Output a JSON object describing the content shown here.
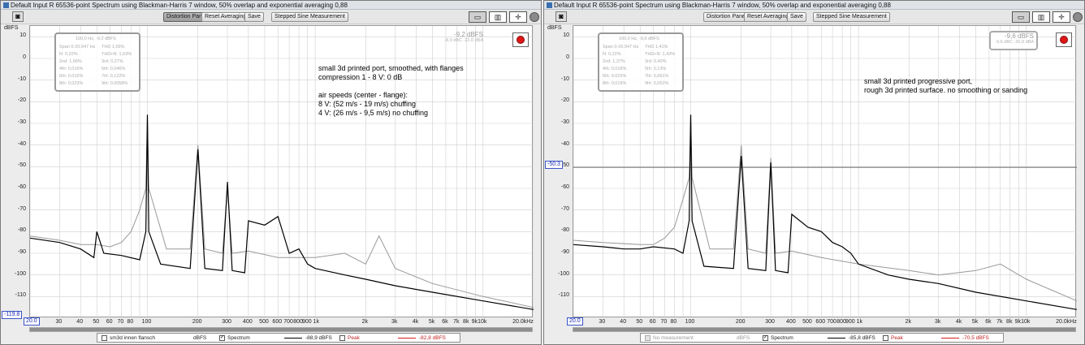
{
  "windows": [
    {
      "title": "Default Input R 65536-point Spectrum using Blackman-Harris 7 window, 50% overlap and exponential averaging 0,88",
      "toolbar": {
        "distortion_panel": "Distortion Panel",
        "reset_averaging": "Reset Averaging",
        "save": "Save",
        "stepped_sine": "Stepped Sine Measurement"
      },
      "y_unit": "dBFS",
      "y_ticks": [
        "10",
        "0",
        "-10",
        "-20",
        "-30",
        "-40",
        "-50",
        "-60",
        "-70",
        "-80",
        "-90",
        "-100",
        "-110"
      ],
      "x_ticks": [
        {
          "label": "30",
          "f": 30
        },
        {
          "label": "40",
          "f": 40
        },
        {
          "label": "50",
          "f": 50
        },
        {
          "label": "60",
          "f": 60
        },
        {
          "label": "70",
          "f": 70
        },
        {
          "label": "80",
          "f": 80
        },
        {
          "label": "100",
          "f": 100
        },
        {
          "label": "200",
          "f": 200
        },
        {
          "label": "300",
          "f": 300
        },
        {
          "label": "400",
          "f": 400
        },
        {
          "label": "500",
          "f": 500
        },
        {
          "label": "600",
          "f": 600
        },
        {
          "label": "700",
          "f": 700
        },
        {
          "label": "800",
          "f": 800
        },
        {
          "label": "900 1k",
          "f": 950
        },
        {
          "label": "2k",
          "f": 2000
        },
        {
          "label": "3k",
          "f": 3000
        },
        {
          "label": "4k",
          "f": 4000
        },
        {
          "label": "5k",
          "f": 5000
        },
        {
          "label": "6k",
          "f": 6000
        },
        {
          "label": "7k",
          "f": 7000
        },
        {
          "label": "8k",
          "f": 8000
        },
        {
          "label": "9k",
          "f": 9000
        },
        {
          "label": "10k",
          "f": 10000
        },
        {
          "label": "20.0kHz",
          "f": 20000
        }
      ],
      "x_start_label": "20.0",
      "y_cursor_label": "-119.8",
      "level": {
        "main": "-9,2 dBFS",
        "sub": "-8,9 dBC   -22,0 dBA"
      },
      "distortion": {
        "header": "100,0 Hz,  -9,2 dBFS",
        "rows": [
          [
            "Span 0-20.947 Hz",
            "THD 1,66%"
          ],
          [
            "N: 0,22%",
            "THD+N: 1,63%"
          ],
          [
            "2nd: 1,66%",
            "3rd: 0,27%"
          ],
          [
            "4th: 0,016%",
            "5th: 0,046%"
          ],
          [
            "6th: 0,016%",
            "7th: 0,122%"
          ],
          [
            "8th: 0,023%",
            "9th: 0,0058%"
          ]
        ]
      },
      "annotation": "small 3d printed port, smoothed, with flanges\ncompression 1 - 8 V: 0 dB\n\nair speeds (center - flange):\n8 V: (52 m/s - 19 m/s) chuffing\n4 V: (26 m/s - 9,5 m/s) no chuffing",
      "legend": {
        "overlay_name": "sm3d innen flansch",
        "overlay_unit": "dBFS",
        "spectrum": "Spectrum",
        "spectrum_value": "-88,9 dBFS",
        "peak": "Peak",
        "peak_value": "-82,8 dBFS"
      },
      "horizontal_cursor": null
    },
    {
      "title": "Default Input R 65536-point Spectrum using Blackman-Harris 7 window, 50% overlap and exponential averaging 0,88",
      "toolbar": {
        "distortion_panel": "Distortion Panel",
        "reset_averaging": "Reset Averaging",
        "save": "Save",
        "stepped_sine": "Stepped Sine Measurement"
      },
      "y_unit": "dBFS",
      "y_ticks": [
        "10",
        "0",
        "-10",
        "-20",
        "-30",
        "-40",
        "-50",
        "-60",
        "-70",
        "-80",
        "-90",
        "-100",
        "-110"
      ],
      "x_ticks": [
        {
          "label": "30",
          "f": 30
        },
        {
          "label": "40",
          "f": 40
        },
        {
          "label": "50",
          "f": 50
        },
        {
          "label": "60",
          "f": 60
        },
        {
          "label": "70",
          "f": 70
        },
        {
          "label": "80",
          "f": 80
        },
        {
          "label": "100",
          "f": 100
        },
        {
          "label": "200",
          "f": 200
        },
        {
          "label": "300",
          "f": 300
        },
        {
          "label": "400",
          "f": 400
        },
        {
          "label": "500",
          "f": 500
        },
        {
          "label": "600",
          "f": 600
        },
        {
          "label": "700",
          "f": 700
        },
        {
          "label": "800",
          "f": 800
        },
        {
          "label": "900 1k",
          "f": 950
        },
        {
          "label": "2k",
          "f": 2000
        },
        {
          "label": "3k",
          "f": 3000
        },
        {
          "label": "4k",
          "f": 4000
        },
        {
          "label": "5k",
          "f": 5000
        },
        {
          "label": "6k",
          "f": 6000
        },
        {
          "label": "7k",
          "f": 7000
        },
        {
          "label": "8k",
          "f": 8000
        },
        {
          "label": "9k",
          "f": 9000
        },
        {
          "label": "10k",
          "f": 10000
        },
        {
          "label": "20.0kHz",
          "f": 20000
        }
      ],
      "x_start_label": "20.0",
      "y_cursor_label": "-50.3",
      "level": {
        "main": "-9,6 dBFS",
        "sub": "-9,6 dBC   -20,9 dBA"
      },
      "distortion": {
        "header": "100,0 Hz,  -9,6 dBFS",
        "rows": [
          [
            "Span 0-20.947 Hz",
            "THD 1,41%"
          ],
          [
            "N: 0,22%",
            "THD+N: 1,43%"
          ],
          [
            "2nd: 1,37%",
            "3rd: 0,40%"
          ],
          [
            "4th: 0,018%",
            "5th: 0,13%"
          ],
          [
            "6th: 0,023%",
            "7th: 0,061%"
          ],
          [
            "8th: 0,019%",
            "9th: 0,052%"
          ]
        ]
      },
      "annotation": "small 3d printed progressive port,\nrough 3d printed surface. no smoothing or sanding",
      "legend": {
        "overlay_name": "No measurement",
        "overlay_unit": "dBFS",
        "spectrum": "Spectrum",
        "spectrum_value": "-85,8 dBFS",
        "peak": "Peak",
        "peak_value": "-70,5 dBFS"
      },
      "horizontal_cursor": -50.3
    }
  ],
  "chart_data": [
    {
      "type": "line",
      "title": "",
      "xlabel": "",
      "ylabel": "dBFS",
      "x_scale": "log",
      "xlim": [
        20,
        20000
      ],
      "ylim": [
        -120,
        15
      ],
      "series": [
        {
          "name": "Spectrum",
          "color": "#000000",
          "x": [
            20,
            30,
            40,
            48,
            50,
            55,
            70,
            90,
            98,
            100,
            102,
            120,
            180,
            200,
            220,
            280,
            300,
            320,
            380,
            400,
            500,
            600,
            700,
            800,
            900,
            1000,
            1500,
            2000,
            3000,
            5000,
            10000,
            20000
          ],
          "y": [
            -83,
            -85,
            -88,
            -92,
            -80,
            -90,
            -91,
            -93,
            -80,
            -26,
            -80,
            -95,
            -97,
            -42,
            -97,
            -98,
            -57,
            -98,
            -99,
            -75,
            -77,
            -73,
            -90,
            -88,
            -95,
            -97,
            -100,
            -102,
            -105,
            -108,
            -112,
            -116
          ]
        },
        {
          "name": "sm3d innen flansch",
          "color": "#999999",
          "x": [
            20,
            30,
            40,
            50,
            60,
            70,
            80,
            90,
            98,
            100,
            102,
            130,
            180,
            200,
            220,
            280,
            300,
            320,
            400,
            600,
            1000,
            1500,
            2000,
            2400,
            3000,
            5000,
            10000,
            20000
          ],
          "y": [
            -82,
            -84,
            -86,
            -86,
            -87,
            -85,
            -80,
            -70,
            -60,
            -27,
            -60,
            -88,
            -88,
            -40,
            -88,
            -90,
            -60,
            -90,
            -89,
            -92,
            -92,
            -90,
            -95,
            -82,
            -97,
            -104,
            -110,
            -115
          ]
        }
      ]
    },
    {
      "type": "line",
      "title": "",
      "xlabel": "",
      "ylabel": "dBFS",
      "x_scale": "log",
      "xlim": [
        20,
        20000
      ],
      "ylim": [
        -120,
        15
      ],
      "series": [
        {
          "name": "Spectrum",
          "color": "#000000",
          "x": [
            20,
            30,
            40,
            50,
            60,
            80,
            90,
            98,
            100,
            102,
            120,
            180,
            200,
            220,
            280,
            300,
            320,
            380,
            400,
            500,
            600,
            700,
            800,
            900,
            1000,
            1500,
            2000,
            3000,
            5000,
            10000,
            20000
          ],
          "y": [
            -86,
            -87,
            -88,
            -88,
            -87,
            -88,
            -90,
            -75,
            -26,
            -75,
            -96,
            -97,
            -45,
            -97,
            -98,
            -48,
            -98,
            -99,
            -72,
            -78,
            -80,
            -85,
            -87,
            -90,
            -95,
            -100,
            -102,
            -104,
            -108,
            -112,
            -116
          ]
        },
        {
          "name": "Peak",
          "color": "#999999",
          "x": [
            20,
            30,
            50,
            60,
            70,
            80,
            90,
            98,
            100,
            102,
            130,
            180,
            200,
            220,
            280,
            300,
            320,
            400,
            600,
            1000,
            2000,
            3000,
            5000,
            7000,
            10000,
            20000
          ],
          "y": [
            -84,
            -85,
            -86,
            -86,
            -83,
            -78,
            -65,
            -55,
            -26,
            -55,
            -88,
            -88,
            -40,
            -88,
            -90,
            -46,
            -90,
            -89,
            -92,
            -95,
            -98,
            -100,
            -98,
            -95,
            -102,
            -112
          ]
        }
      ]
    }
  ]
}
